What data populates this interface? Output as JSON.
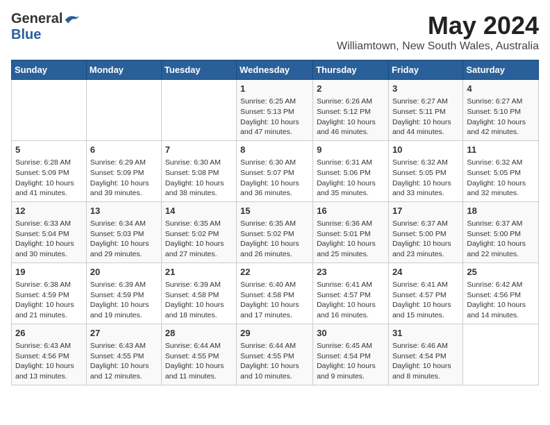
{
  "logo": {
    "general": "General",
    "blue": "Blue"
  },
  "title": {
    "month_year": "May 2024",
    "location": "Williamtown, New South Wales, Australia"
  },
  "days_of_week": [
    "Sunday",
    "Monday",
    "Tuesday",
    "Wednesday",
    "Thursday",
    "Friday",
    "Saturday"
  ],
  "weeks": [
    [
      {
        "day": "",
        "content": ""
      },
      {
        "day": "",
        "content": ""
      },
      {
        "day": "",
        "content": ""
      },
      {
        "day": "1",
        "content": "Sunrise: 6:25 AM\nSunset: 5:13 PM\nDaylight: 10 hours and 47 minutes."
      },
      {
        "day": "2",
        "content": "Sunrise: 6:26 AM\nSunset: 5:12 PM\nDaylight: 10 hours and 46 minutes."
      },
      {
        "day": "3",
        "content": "Sunrise: 6:27 AM\nSunset: 5:11 PM\nDaylight: 10 hours and 44 minutes."
      },
      {
        "day": "4",
        "content": "Sunrise: 6:27 AM\nSunset: 5:10 PM\nDaylight: 10 hours and 42 minutes."
      }
    ],
    [
      {
        "day": "5",
        "content": "Sunrise: 6:28 AM\nSunset: 5:09 PM\nDaylight: 10 hours and 41 minutes."
      },
      {
        "day": "6",
        "content": "Sunrise: 6:29 AM\nSunset: 5:09 PM\nDaylight: 10 hours and 39 minutes."
      },
      {
        "day": "7",
        "content": "Sunrise: 6:30 AM\nSunset: 5:08 PM\nDaylight: 10 hours and 38 minutes."
      },
      {
        "day": "8",
        "content": "Sunrise: 6:30 AM\nSunset: 5:07 PM\nDaylight: 10 hours and 36 minutes."
      },
      {
        "day": "9",
        "content": "Sunrise: 6:31 AM\nSunset: 5:06 PM\nDaylight: 10 hours and 35 minutes."
      },
      {
        "day": "10",
        "content": "Sunrise: 6:32 AM\nSunset: 5:05 PM\nDaylight: 10 hours and 33 minutes."
      },
      {
        "day": "11",
        "content": "Sunrise: 6:32 AM\nSunset: 5:05 PM\nDaylight: 10 hours and 32 minutes."
      }
    ],
    [
      {
        "day": "12",
        "content": "Sunrise: 6:33 AM\nSunset: 5:04 PM\nDaylight: 10 hours and 30 minutes."
      },
      {
        "day": "13",
        "content": "Sunrise: 6:34 AM\nSunset: 5:03 PM\nDaylight: 10 hours and 29 minutes."
      },
      {
        "day": "14",
        "content": "Sunrise: 6:35 AM\nSunset: 5:02 PM\nDaylight: 10 hours and 27 minutes."
      },
      {
        "day": "15",
        "content": "Sunrise: 6:35 AM\nSunset: 5:02 PM\nDaylight: 10 hours and 26 minutes."
      },
      {
        "day": "16",
        "content": "Sunrise: 6:36 AM\nSunset: 5:01 PM\nDaylight: 10 hours and 25 minutes."
      },
      {
        "day": "17",
        "content": "Sunrise: 6:37 AM\nSunset: 5:00 PM\nDaylight: 10 hours and 23 minutes."
      },
      {
        "day": "18",
        "content": "Sunrise: 6:37 AM\nSunset: 5:00 PM\nDaylight: 10 hours and 22 minutes."
      }
    ],
    [
      {
        "day": "19",
        "content": "Sunrise: 6:38 AM\nSunset: 4:59 PM\nDaylight: 10 hours and 21 minutes."
      },
      {
        "day": "20",
        "content": "Sunrise: 6:39 AM\nSunset: 4:59 PM\nDaylight: 10 hours and 19 minutes."
      },
      {
        "day": "21",
        "content": "Sunrise: 6:39 AM\nSunset: 4:58 PM\nDaylight: 10 hours and 18 minutes."
      },
      {
        "day": "22",
        "content": "Sunrise: 6:40 AM\nSunset: 4:58 PM\nDaylight: 10 hours and 17 minutes."
      },
      {
        "day": "23",
        "content": "Sunrise: 6:41 AM\nSunset: 4:57 PM\nDaylight: 10 hours and 16 minutes."
      },
      {
        "day": "24",
        "content": "Sunrise: 6:41 AM\nSunset: 4:57 PM\nDaylight: 10 hours and 15 minutes."
      },
      {
        "day": "25",
        "content": "Sunrise: 6:42 AM\nSunset: 4:56 PM\nDaylight: 10 hours and 14 minutes."
      }
    ],
    [
      {
        "day": "26",
        "content": "Sunrise: 6:43 AM\nSunset: 4:56 PM\nDaylight: 10 hours and 13 minutes."
      },
      {
        "day": "27",
        "content": "Sunrise: 6:43 AM\nSunset: 4:55 PM\nDaylight: 10 hours and 12 minutes."
      },
      {
        "day": "28",
        "content": "Sunrise: 6:44 AM\nSunset: 4:55 PM\nDaylight: 10 hours and 11 minutes."
      },
      {
        "day": "29",
        "content": "Sunrise: 6:44 AM\nSunset: 4:55 PM\nDaylight: 10 hours and 10 minutes."
      },
      {
        "day": "30",
        "content": "Sunrise: 6:45 AM\nSunset: 4:54 PM\nDaylight: 10 hours and 9 minutes."
      },
      {
        "day": "31",
        "content": "Sunrise: 6:46 AM\nSunset: 4:54 PM\nDaylight: 10 hours and 8 minutes."
      },
      {
        "day": "",
        "content": ""
      }
    ]
  ]
}
